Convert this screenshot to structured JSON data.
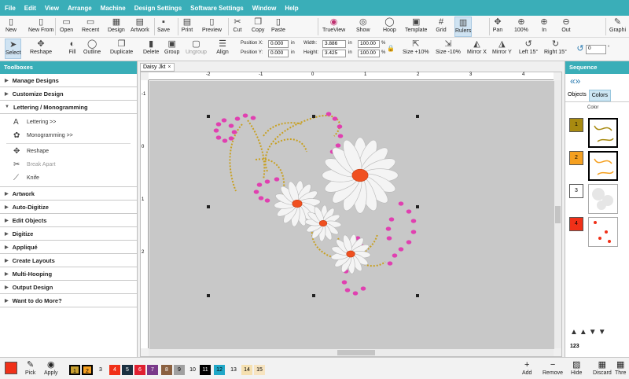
{
  "menu": [
    "File",
    "Edit",
    "View",
    "Arrange",
    "Machine",
    "Design Settings",
    "Software Settings",
    "Window",
    "Help"
  ],
  "toolbar1": [
    {
      "label": "New",
      "icon": "new-file-icon"
    },
    {
      "label": "New From",
      "icon": "new-from-icon"
    },
    {
      "label": "Open",
      "icon": "open-folder-icon"
    },
    {
      "label": "Recent",
      "icon": "recent-icon"
    },
    {
      "label": "Design",
      "icon": "design-icon"
    },
    {
      "label": "Artwork",
      "icon": "artwork-icon"
    },
    {
      "label": "Save",
      "icon": "save-icon"
    },
    {
      "label": "Print",
      "icon": "print-icon"
    },
    {
      "label": "Preview",
      "icon": "preview-icon"
    },
    {
      "label": "Cut",
      "icon": "scissors-icon"
    },
    {
      "label": "Copy",
      "icon": "copy-icon"
    },
    {
      "label": "Paste",
      "icon": "paste-icon"
    },
    {
      "label": "TrueView",
      "icon": "trueview-icon"
    },
    {
      "label": "Show",
      "icon": "show-icon"
    },
    {
      "label": "Hoop",
      "icon": "hoop-icon"
    },
    {
      "label": "Template",
      "icon": "template-icon"
    },
    {
      "label": "Grid",
      "icon": "grid-icon"
    },
    {
      "label": "Rulers",
      "icon": "rulers-icon"
    },
    {
      "label": "Pan",
      "icon": "pan-icon"
    },
    {
      "label": "100%",
      "icon": "zoom-100-icon"
    },
    {
      "label": "In",
      "icon": "zoom-in-icon"
    },
    {
      "label": "Out",
      "icon": "zoom-out-icon"
    },
    {
      "label": "Graphi",
      "icon": "graphics-icon"
    }
  ],
  "toolbar2": {
    "buttons": [
      {
        "label": "Select",
        "icon": "select-arrow-icon"
      },
      {
        "label": "Reshape",
        "icon": "reshape-icon"
      },
      {
        "label": "Fill",
        "icon": "fill-icon"
      },
      {
        "label": "Outline",
        "icon": "outline-icon"
      },
      {
        "label": "Duplicate",
        "icon": "duplicate-icon"
      },
      {
        "label": "Delete",
        "icon": "trash-icon"
      },
      {
        "label": "Group",
        "icon": "group-icon"
      },
      {
        "label": "Ungroup",
        "icon": "ungroup-icon"
      },
      {
        "label": "Align",
        "icon": "align-icon"
      }
    ],
    "position_x_label": "Position X:",
    "position_y_label": "Position Y:",
    "position_x": "0.000",
    "position_y": "0.000",
    "width_label": "Width:",
    "height_label": "Height:",
    "width": "3.886",
    "height": "3.425",
    "unit": "in",
    "scale_w": "100.00",
    "scale_h": "100.00",
    "percent": "%",
    "tools": [
      {
        "label": "Size +10%",
        "icon": "size-up-icon"
      },
      {
        "label": "Size -10%",
        "icon": "size-down-icon"
      },
      {
        "label": "Mirror X",
        "icon": "mirror-x-icon"
      },
      {
        "label": "Mirror Y",
        "icon": "mirror-y-icon"
      },
      {
        "label": "Left 15°",
        "icon": "rotate-left-icon"
      },
      {
        "label": "Right 15°",
        "icon": "rotate-right-icon"
      }
    ],
    "rotation": "0",
    "rotation_unit": "°"
  },
  "left_panel": {
    "title": "Toolboxes",
    "groups_top": [
      "Manage Designs",
      "Customize Design",
      "Lettering / Monogramming"
    ],
    "subitems": [
      {
        "label": "Lettering >>",
        "icon": "lettering-icon"
      },
      {
        "label": "Monogramming >>",
        "icon": "monogram-icon"
      },
      {
        "label": "Reshape",
        "icon": "reshape-icon"
      },
      {
        "label": "Break Apart",
        "icon": "break-apart-icon"
      },
      {
        "label": "Knife",
        "icon": "knife-icon"
      }
    ],
    "groups_bottom": [
      "Artwork",
      "Auto-Digitize",
      "Edit Objects",
      "Digitize",
      "Appliqué",
      "Create Layouts",
      "Multi-Hooping",
      "Output Design",
      "Want to do More?"
    ]
  },
  "document": {
    "tab": "Daisy Jkt",
    "ruler_h": [
      "-2",
      "-1",
      "0",
      "1",
      "2",
      "3",
      "4"
    ],
    "ruler_v": [
      "-1",
      "0",
      "1",
      "2"
    ]
  },
  "right_panel": {
    "title": "Sequence",
    "tabs": [
      "Objects",
      "Colors"
    ],
    "color_label": "Color",
    "items": [
      {
        "num": "1",
        "color": "#a88a10"
      },
      {
        "num": "2",
        "color": "#f5a020"
      },
      {
        "num": "3",
        "color": "#ffffff"
      },
      {
        "num": "4",
        "color": "#f03018"
      }
    ],
    "counter": "123"
  },
  "bottom": {
    "current_color": "#f03018",
    "pick_label": "Pick",
    "apply_label": "Apply",
    "palette": [
      {
        "num": "1",
        "color": "#c8a030",
        "text": "#000"
      },
      {
        "num": "2",
        "color": "#f5a020",
        "text": "#000"
      },
      {
        "num": "3",
        "color": "#ffffff",
        "text": "#000"
      },
      {
        "num": "4",
        "color": "#f03018",
        "text": "#fff"
      },
      {
        "num": "5",
        "color": "#1a3040",
        "text": "#fff"
      },
      {
        "num": "6",
        "color": "#e02030",
        "text": "#fff"
      },
      {
        "num": "7",
        "color": "#7a3a8a",
        "text": "#fff"
      },
      {
        "num": "8",
        "color": "#8a6040",
        "text": "#fff"
      },
      {
        "num": "9",
        "color": "#a0a0a0",
        "text": "#000"
      },
      {
        "num": "10",
        "color": "#ffffff",
        "text": "#000"
      },
      {
        "num": "11",
        "color": "#000000",
        "text": "#fff"
      },
      {
        "num": "12",
        "color": "#20a8c8",
        "text": "#000"
      },
      {
        "num": "13",
        "color": "#ffffff",
        "text": "#000"
      },
      {
        "num": "14",
        "color": "#f5e0b0",
        "text": "#000"
      },
      {
        "num": "15",
        "color": "#f7e4c0",
        "text": "#000"
      }
    ],
    "actions": [
      {
        "label": "Add",
        "icon": "plus-icon"
      },
      {
        "label": "Remove",
        "icon": "minus-icon"
      },
      {
        "label": "Hide",
        "icon": "hide-icon"
      },
      {
        "label": "Discard",
        "icon": "discard-icon"
      },
      {
        "label": "Thre",
        "icon": "thread-icon"
      }
    ]
  },
  "colors": {
    "accent": "#3aaeb8",
    "canvas": "#c8c8c8",
    "gold": "#c8a020",
    "pink": "#e040b0",
    "petal": "#f4f4f4",
    "center": "#f05020"
  }
}
